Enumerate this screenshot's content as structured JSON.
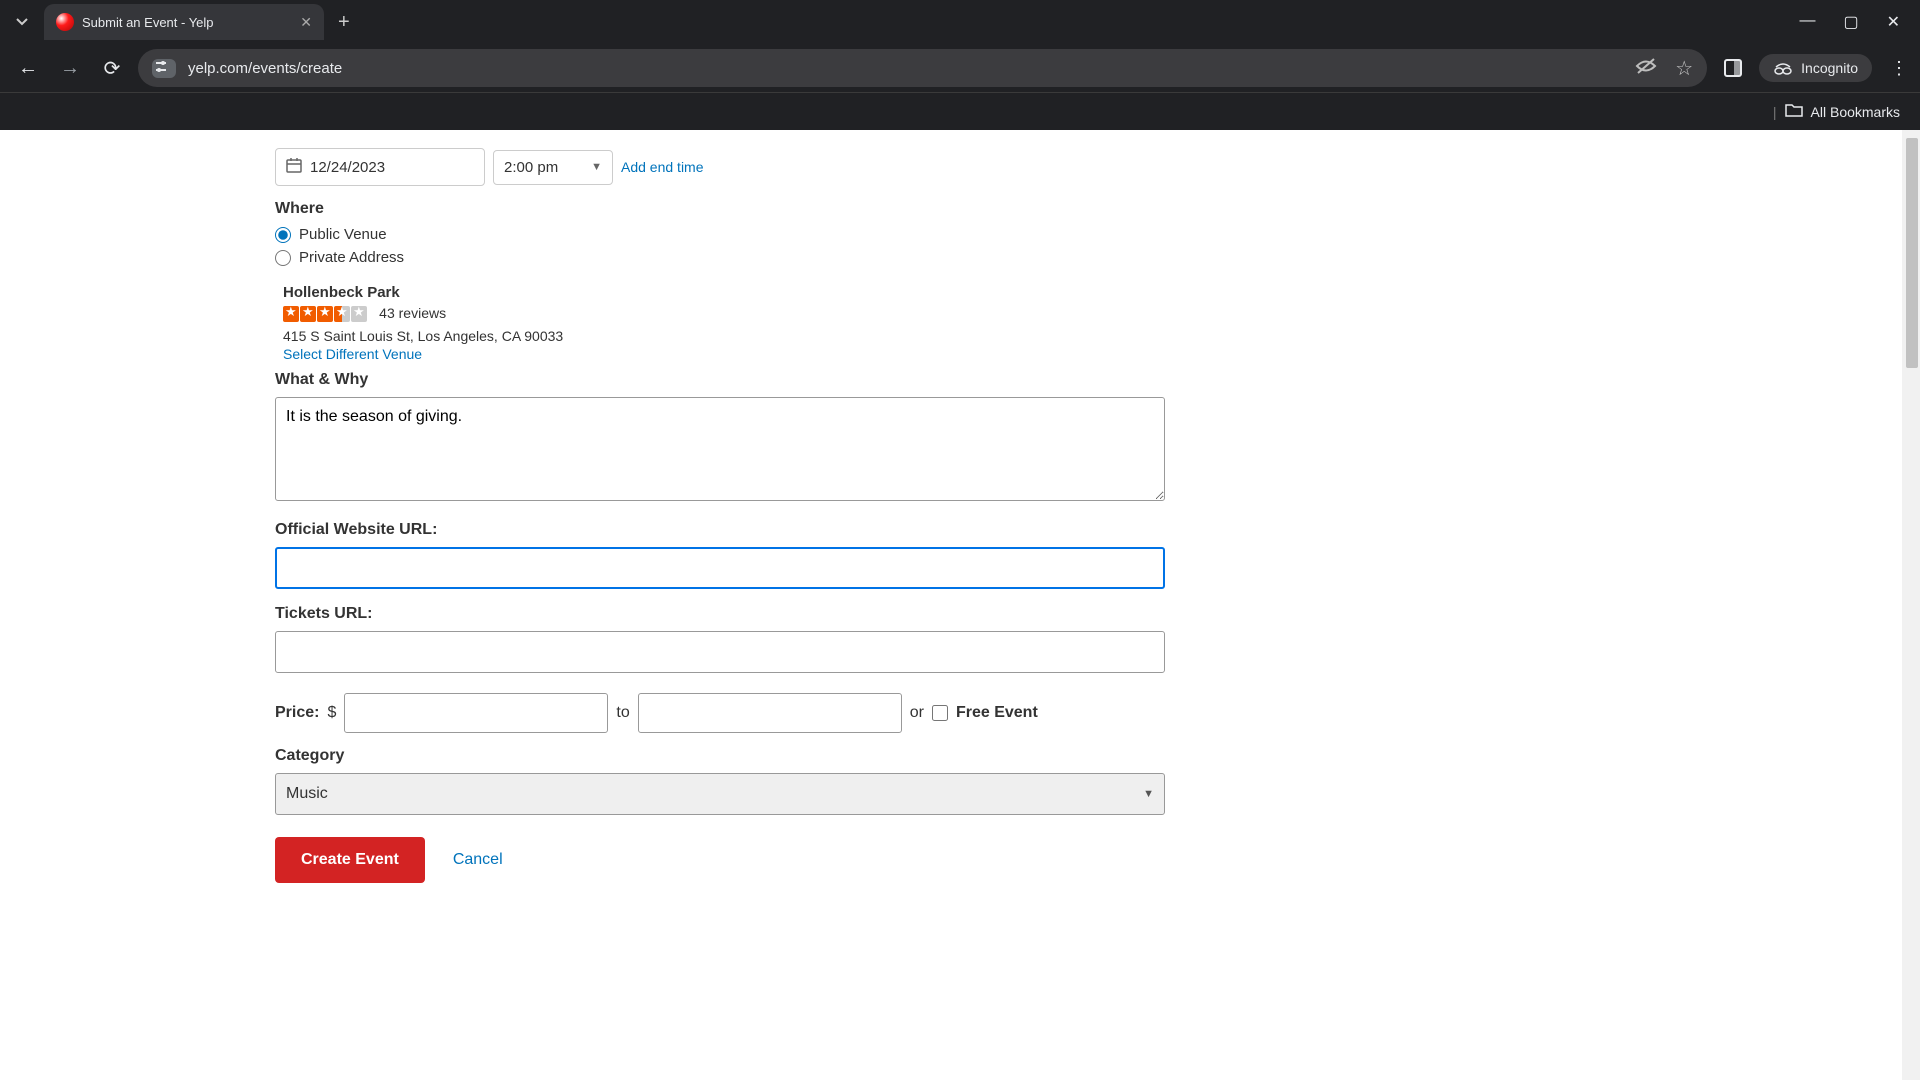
{
  "browser": {
    "tab_title": "Submit an Event - Yelp",
    "url": "yelp.com/events/create",
    "incognito_label": "Incognito",
    "all_bookmarks": "All Bookmarks"
  },
  "form": {
    "date": "12/24/2023",
    "time": "2:00 pm",
    "add_end_time": "Add end time",
    "where_label": "Where",
    "venue_options": {
      "public": "Public Venue",
      "private": "Private Address"
    },
    "venue": {
      "name": "Hollenbeck Park",
      "review_count": "43 reviews",
      "address": "415 S Saint Louis St, Los Angeles, CA 90033",
      "select_different": "Select Different Venue"
    },
    "what_why_label": "What & Why",
    "what_why_value": "It is the season of giving.",
    "website_label": "Official Website URL:",
    "website_value": "",
    "tickets_label": "Tickets URL:",
    "tickets_value": "",
    "price_label": "Price:",
    "price_currency": "$",
    "price_to": "to",
    "price_or": "or",
    "free_event_label": "Free Event",
    "category_label": "Category",
    "category_value": "Music",
    "create_button": "Create Event",
    "cancel_button": "Cancel"
  }
}
